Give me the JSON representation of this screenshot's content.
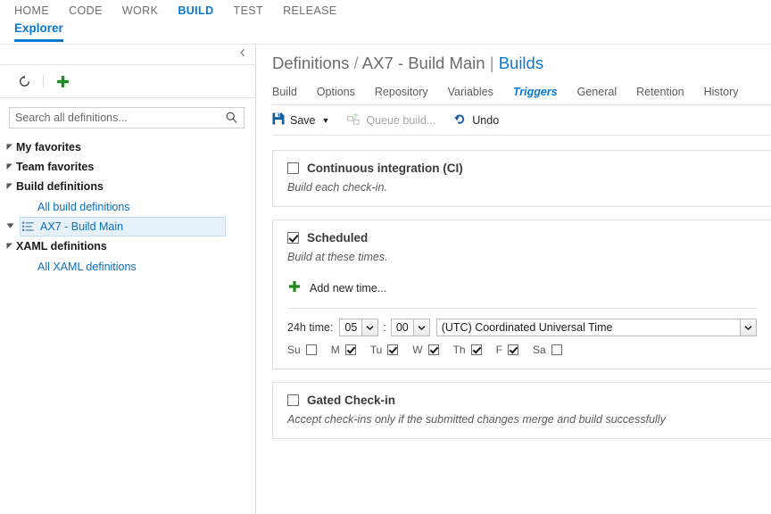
{
  "topnav": {
    "hubs": [
      {
        "label": "HOME",
        "active": false
      },
      {
        "label": "CODE",
        "active": false
      },
      {
        "label": "WORK",
        "active": false
      },
      {
        "label": "BUILD",
        "active": true
      },
      {
        "label": "TEST",
        "active": false
      },
      {
        "label": "RELEASE",
        "active": false
      }
    ],
    "pivot": "Explorer"
  },
  "sidebar": {
    "collapse_icon": "chevron-left-icon",
    "toolbar": {
      "refresh_icon": "refresh-icon",
      "add_icon": "plus-icon"
    },
    "search": {
      "placeholder": "Search all definitions...",
      "value": "",
      "icon": "search-icon"
    },
    "tree": [
      {
        "label": "My favorites",
        "type": "group",
        "expander": "◢"
      },
      {
        "label": "Team favorites",
        "type": "group",
        "expander": "◢"
      },
      {
        "label": "Build definitions",
        "type": "group",
        "expander": "◢"
      },
      {
        "label": "All build definitions",
        "type": "link"
      },
      {
        "label": "AX7 - Build Main",
        "type": "definition",
        "selected": true,
        "caret": "▼"
      },
      {
        "label": "XAML definitions",
        "type": "group",
        "expander": "◢"
      },
      {
        "label": "All XAML definitions",
        "type": "link"
      }
    ]
  },
  "main": {
    "breadcrumb": {
      "root": "Definitions",
      "separator": "/",
      "name": "AX7 - Build Main",
      "pipe": "|",
      "link": "Builds"
    },
    "tabs": [
      {
        "label": "Build",
        "active": false
      },
      {
        "label": "Options",
        "active": false
      },
      {
        "label": "Repository",
        "active": false
      },
      {
        "label": "Variables",
        "active": false
      },
      {
        "label": "Triggers",
        "active": true
      },
      {
        "label": "General",
        "active": false
      },
      {
        "label": "Retention",
        "active": false
      },
      {
        "label": "History",
        "active": false
      }
    ],
    "commands": {
      "save": {
        "label": "Save",
        "icon": "save-icon",
        "caret": "▼",
        "disabled": false
      },
      "queue": {
        "label": "Queue build...",
        "icon": "queue-build-icon",
        "disabled": true
      },
      "undo": {
        "label": "Undo",
        "icon": "undo-icon",
        "disabled": false
      }
    },
    "triggers": {
      "ci": {
        "title": "Continuous integration (CI)",
        "subtitle": "Build each check-in.",
        "checked": false
      },
      "scheduled": {
        "title": "Scheduled",
        "subtitle": "Build at these times.",
        "checked": true,
        "add_new_time": {
          "label": "Add new time...",
          "icon": "plus-icon"
        },
        "rule": {
          "time_label": "24h time:",
          "hour": "05",
          "minute": "00",
          "colon": ":",
          "timezone": "(UTC) Coordinated Universal Time",
          "days": [
            {
              "label": "Su",
              "checked": false
            },
            {
              "label": "M",
              "checked": true
            },
            {
              "label": "Tu",
              "checked": true
            },
            {
              "label": "W",
              "checked": true
            },
            {
              "label": "Th",
              "checked": true
            },
            {
              "label": "F",
              "checked": true
            },
            {
              "label": "Sa",
              "checked": false
            }
          ]
        }
      },
      "gated": {
        "title": "Gated Check-in",
        "subtitle": "Accept check-ins only if the submitted changes merge and build successfully",
        "checked": false
      }
    }
  },
  "colors": {
    "accent": "#0878d1",
    "green": "#1c8a1c",
    "selection_bg": "#e7f1f9",
    "border": "#dedede"
  }
}
